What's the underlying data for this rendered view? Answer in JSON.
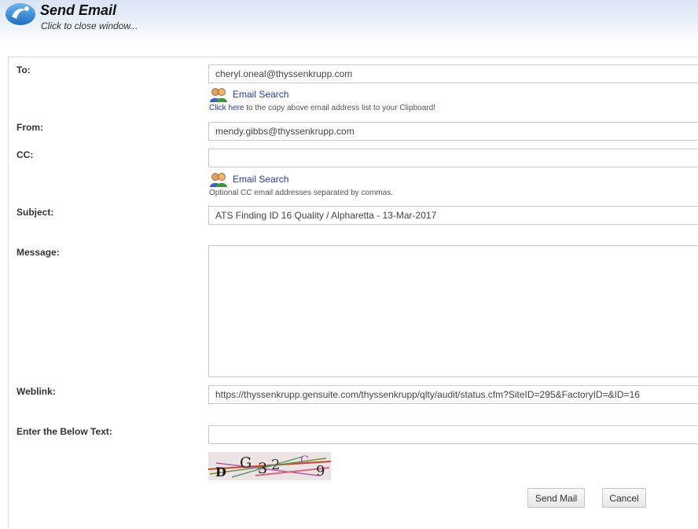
{
  "header": {
    "title": "Send Email",
    "subtitle": "Click to close window..."
  },
  "form": {
    "to": {
      "label": "To:",
      "value": "cheryl.oneal@thyssenkrupp.com",
      "search_label": "Email Search",
      "clipboard_link": "Click here",
      "clipboard_text": " to the copy above email address list to your Clipboard!"
    },
    "from": {
      "label": "From:",
      "value": "mendy.gibbs@thyssenkrupp.com"
    },
    "cc": {
      "label": "CC:",
      "value": "",
      "search_label": "Email Search",
      "hint": "Optional CC email addresses separated by commas."
    },
    "subject": {
      "label": "Subject:",
      "value": "ATS Finding ID 16 Quality / Alpharetta - 13-Mar-2017"
    },
    "message": {
      "label": "Message:",
      "value": ""
    },
    "weblink": {
      "label": "Weblink:",
      "value": "https://thyssenkrupp.gensuite.com/thyssenkrupp/qlty/audit/status.cfm?SiteID=295&FactoryID=&ID=16"
    },
    "captcha": {
      "label": "Enter the Below Text:",
      "value": "",
      "glyphs": [
        "D",
        "G",
        "3",
        "2",
        "C",
        "9"
      ]
    }
  },
  "buttons": {
    "send": "Send Mail",
    "cancel": "Cancel"
  },
  "icons": {
    "logo": "app-logo-icon",
    "people": "people-icon"
  },
  "colors": {
    "link": "#1f3e99",
    "header_gradient_top": "#d9e4f4",
    "logo_blue": "#3a8ad6"
  }
}
